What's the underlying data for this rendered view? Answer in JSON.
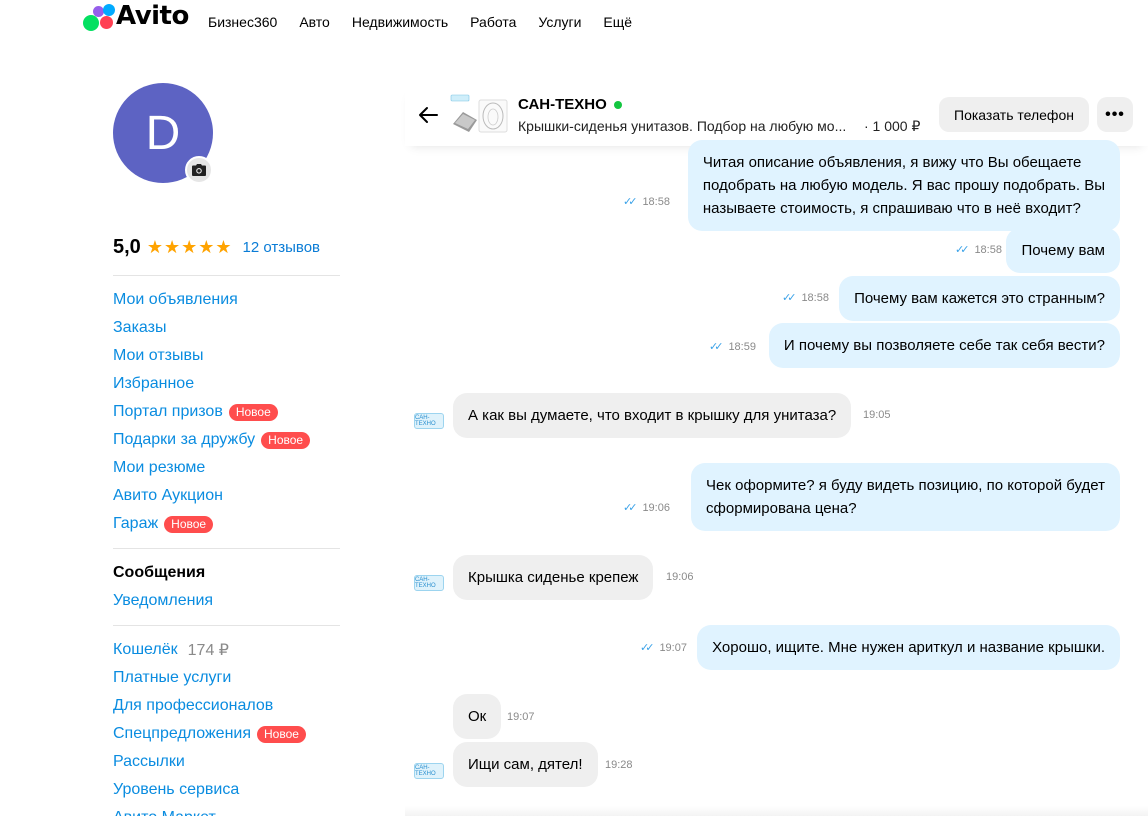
{
  "header": {
    "logo_text": "Avito",
    "nav": [
      "Бизнес360",
      "Авто",
      "Недвижимость",
      "Работа",
      "Услуги",
      "Ещё"
    ]
  },
  "profile": {
    "avatar_letter": "D",
    "rating": "5,0",
    "stars": "★★★★★",
    "stars_value": 5,
    "reviews": "12 отзывов"
  },
  "menu": {
    "group1": [
      {
        "label": "Мои объявления"
      },
      {
        "label": "Заказы"
      },
      {
        "label": "Мои отзывы"
      },
      {
        "label": "Избранное"
      },
      {
        "label": "Портал призов",
        "badge": "Новое"
      },
      {
        "label": "Подарки за дружбу",
        "badge": "Новое"
      },
      {
        "label": "Мои резюме"
      },
      {
        "label": "Авито Аукцион"
      },
      {
        "label": "Гараж",
        "badge": "Новое"
      }
    ],
    "group2": [
      {
        "label": "Сообщения",
        "bold": true
      },
      {
        "label": "Уведомления"
      }
    ],
    "group3": [
      {
        "label": "Кошелёк",
        "value": "174 ₽"
      },
      {
        "label": "Платные услуги"
      },
      {
        "label": "Для профессионалов"
      },
      {
        "label": "Спецпредложения",
        "badge": "Новое"
      },
      {
        "label": "Рассылки"
      },
      {
        "label": "Уровень сервиса"
      },
      {
        "label": "Авито Маркет"
      }
    ]
  },
  "chat": {
    "seller_name": "САН-ТЕХНО",
    "item_title": "Крышки-сиденья унитазов. Подбор на любую мо...",
    "item_price": "· 1 000 ₽",
    "show_phone": "Показать телефон",
    "more": "•••",
    "avatar_text": "САН-ТЕХНО",
    "messages": [
      {
        "dir": "out",
        "lines": [
          "Читая описание объявления, я вижу что Вы обещаете",
          "подобрать на любую модель. Я вас прошу подобрать. Вы",
          "называете стоимость, я спрашиваю что в неё входит?"
        ],
        "time": "18:58"
      },
      {
        "dir": "out",
        "lines": [
          "Почему вам"
        ],
        "time": "18:58"
      },
      {
        "dir": "out",
        "lines": [
          "Почему вам кажется это странным?"
        ],
        "time": "18:58"
      },
      {
        "dir": "out",
        "lines": [
          "И почему вы позволяете себе так себя вести?"
        ],
        "time": "18:59"
      },
      {
        "dir": "in",
        "lines": [
          "А как вы думаете, что входит в крышку для унитаза?"
        ],
        "time": "19:05"
      },
      {
        "dir": "out",
        "lines": [
          "Чек оформите? я буду видеть позицию, по которой будет",
          "сформирована цена?"
        ],
        "time": "19:06"
      },
      {
        "dir": "in",
        "lines": [
          "Крышка сиденье крепеж"
        ],
        "time": "19:06"
      },
      {
        "dir": "out",
        "lines": [
          "Хорошо, ищите. Мне нужен ариткул и название крышки."
        ],
        "time": "19:07"
      },
      {
        "dir": "in",
        "lines": [
          "Ок"
        ],
        "time": "19:07"
      },
      {
        "dir": "in",
        "lines": [
          "Ищи сам, дятел!"
        ],
        "time": "19:28"
      }
    ]
  }
}
